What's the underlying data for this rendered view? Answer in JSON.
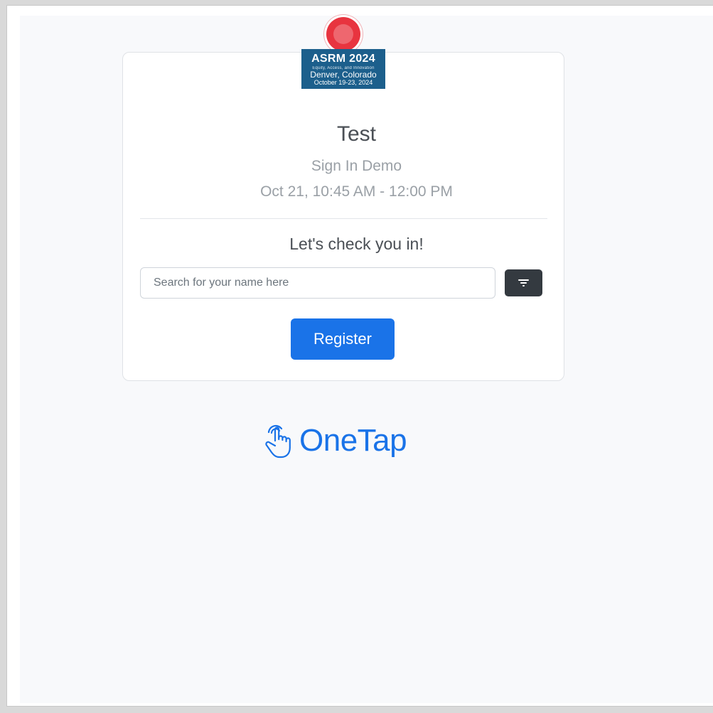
{
  "badge": {
    "title": "ASRM 2024",
    "tagline": "Equity, Access, and Innovation",
    "city": "Denver, Colorado",
    "dates": "October 19-23, 2024"
  },
  "event": {
    "title": "Test",
    "subtitle": "Sign In Demo",
    "datetime": "Oct 21, 10:45 AM - 12:00 PM"
  },
  "checkin": {
    "prompt": "Let's check you in!",
    "search_placeholder": "Search for your name here",
    "search_value": "",
    "filter_icon": "filter-icon",
    "register_label": "Register"
  },
  "brand": {
    "name": "OneTap",
    "icon": "tap-hand-icon",
    "color": "#1a73e8"
  },
  "colors": {
    "primary": "#1a73e8",
    "dark_button": "#343a40",
    "badge_blue": "#1c5f8c",
    "badge_red": "#e8343f"
  }
}
